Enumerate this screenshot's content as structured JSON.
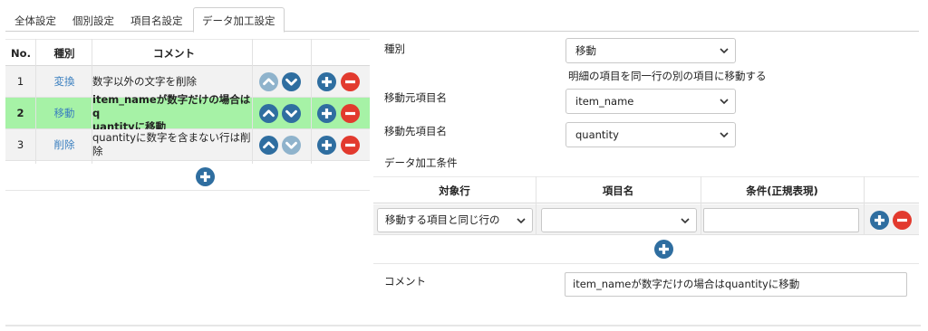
{
  "tabs": [
    "全体設定",
    "個別設定",
    "項目名設定",
    "データ加工設定"
  ],
  "active_tab": 3,
  "left_table": {
    "headers": {
      "no": "No.",
      "kind": "種別",
      "comment": "コメント"
    },
    "rows": [
      {
        "no": "1",
        "kind": "変換",
        "comment_line1": "数字以外の文字を削除",
        "comment_line2": ""
      },
      {
        "no": "2",
        "kind": "移動",
        "comment_line1": "item_nameが数字だけの場合はq",
        "comment_line2": "uantityに移動"
      },
      {
        "no": "3",
        "kind": "削除",
        "comment_line1": "quantityに数字を含まない行は削",
        "comment_line2": "除"
      }
    ]
  },
  "form": {
    "kind_label": "種別",
    "kind_value": "移動",
    "kind_note": "明細の項目を同一行の別の項目に移動する",
    "source_label": "移動元項目名",
    "source_value": "item_name",
    "dest_label": "移動先項目名",
    "dest_value": "quantity",
    "condition_label": "データ加工条件",
    "condition_table": {
      "headers": {
        "target_row": "対象行",
        "item_name": "項目名",
        "condition": "条件(正規表現)"
      },
      "row": {
        "target_row": "移動する項目と同じ行の",
        "item_name": "",
        "condition": ""
      }
    },
    "comment_label": "コメント",
    "comment_value": "item_nameが数字だけの場合はquantityに移動"
  },
  "colors": {
    "selected_row": "#a6f2a6",
    "link": "#3a7fbf",
    "icon_blue": "#2f6ea0",
    "icon_blue_light": "#8fb3cc",
    "icon_red": "#e23a2e"
  },
  "icons": [
    "chevron-up-icon",
    "chevron-down-icon",
    "plus-icon",
    "minus-icon"
  ]
}
